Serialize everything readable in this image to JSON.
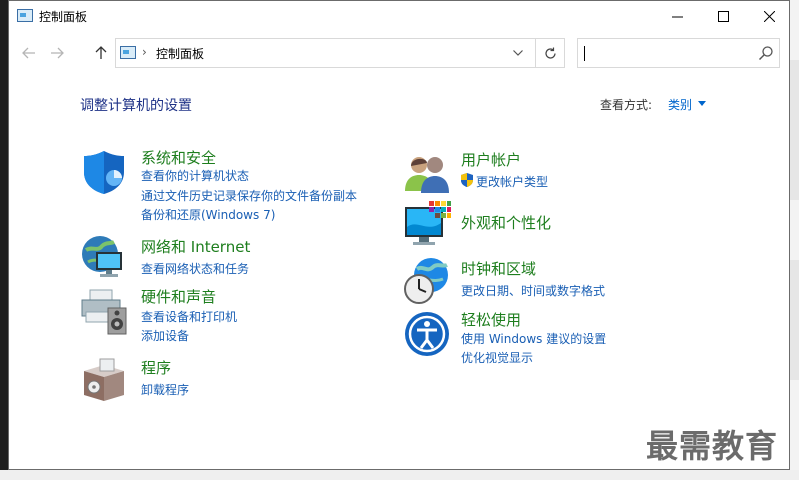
{
  "window": {
    "title": "控制面板",
    "controls": {
      "minimize": "minimize",
      "maximize": "maximize",
      "close": "close"
    }
  },
  "nav": {
    "breadcrumb": "控制面板",
    "search_value": ""
  },
  "main": {
    "heading": "调整计算机的设置",
    "view_by_label": "查看方式:",
    "view_by_value": "类别"
  },
  "categories": [
    {
      "title": "系统和安全",
      "icon": "shield-icon",
      "links": [
        "查看你的计算机状态",
        "通过文件历史记录保存你的文件备份副本",
        "备份和还原(Windows 7)"
      ]
    },
    {
      "title": "网络和 Internet",
      "icon": "network-globe-icon",
      "links": [
        "查看网络状态和任务"
      ]
    },
    {
      "title": "硬件和声音",
      "icon": "printer-speaker-icon",
      "links": [
        "查看设备和打印机",
        "添加设备"
      ]
    },
    {
      "title": "程序",
      "icon": "programs-box-icon",
      "links": [
        "卸载程序"
      ]
    },
    {
      "title": "用户帐户",
      "icon": "users-icon",
      "links": [
        "更改帐户类型"
      ]
    },
    {
      "title": "外观和个性化",
      "icon": "monitor-palette-icon",
      "links": []
    },
    {
      "title": "时钟和区域",
      "icon": "clock-globe-icon",
      "links": [
        "更改日期、时间或数字格式"
      ]
    },
    {
      "title": "轻松使用",
      "icon": "ease-of-access-icon",
      "links": [
        "使用 Windows 建议的设置",
        "优化视觉显示"
      ]
    }
  ],
  "watermark": "最需教育",
  "colors": {
    "heading": "#1e3287",
    "category_title": "#1e7e1e",
    "link": "#1a5fb4"
  }
}
